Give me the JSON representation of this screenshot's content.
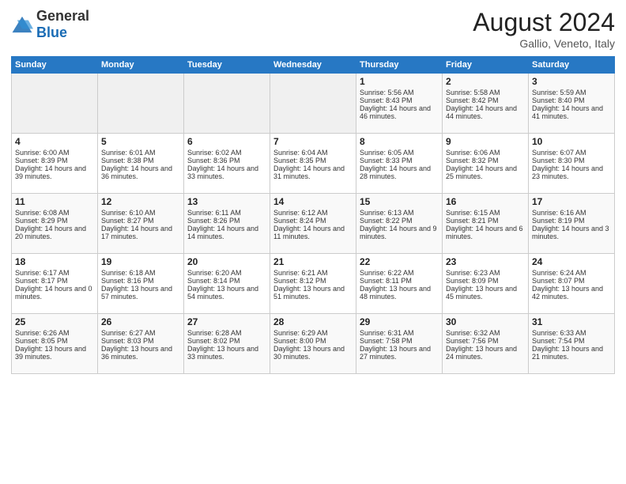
{
  "header": {
    "logo_general": "General",
    "logo_blue": "Blue",
    "title": "August 2024",
    "subtitle": "Gallio, Veneto, Italy"
  },
  "days_of_week": [
    "Sunday",
    "Monday",
    "Tuesday",
    "Wednesday",
    "Thursday",
    "Friday",
    "Saturday"
  ],
  "weeks": [
    [
      {
        "day": "",
        "info": ""
      },
      {
        "day": "",
        "info": ""
      },
      {
        "day": "",
        "info": ""
      },
      {
        "day": "",
        "info": ""
      },
      {
        "day": "1",
        "info": "Sunrise: 5:56 AM\nSunset: 8:43 PM\nDaylight: 14 hours and 46 minutes."
      },
      {
        "day": "2",
        "info": "Sunrise: 5:58 AM\nSunset: 8:42 PM\nDaylight: 14 hours and 44 minutes."
      },
      {
        "day": "3",
        "info": "Sunrise: 5:59 AM\nSunset: 8:40 PM\nDaylight: 14 hours and 41 minutes."
      }
    ],
    [
      {
        "day": "4",
        "info": "Sunrise: 6:00 AM\nSunset: 8:39 PM\nDaylight: 14 hours and 39 minutes."
      },
      {
        "day": "5",
        "info": "Sunrise: 6:01 AM\nSunset: 8:38 PM\nDaylight: 14 hours and 36 minutes."
      },
      {
        "day": "6",
        "info": "Sunrise: 6:02 AM\nSunset: 8:36 PM\nDaylight: 14 hours and 33 minutes."
      },
      {
        "day": "7",
        "info": "Sunrise: 6:04 AM\nSunset: 8:35 PM\nDaylight: 14 hours and 31 minutes."
      },
      {
        "day": "8",
        "info": "Sunrise: 6:05 AM\nSunset: 8:33 PM\nDaylight: 14 hours and 28 minutes."
      },
      {
        "day": "9",
        "info": "Sunrise: 6:06 AM\nSunset: 8:32 PM\nDaylight: 14 hours and 25 minutes."
      },
      {
        "day": "10",
        "info": "Sunrise: 6:07 AM\nSunset: 8:30 PM\nDaylight: 14 hours and 23 minutes."
      }
    ],
    [
      {
        "day": "11",
        "info": "Sunrise: 6:08 AM\nSunset: 8:29 PM\nDaylight: 14 hours and 20 minutes."
      },
      {
        "day": "12",
        "info": "Sunrise: 6:10 AM\nSunset: 8:27 PM\nDaylight: 14 hours and 17 minutes."
      },
      {
        "day": "13",
        "info": "Sunrise: 6:11 AM\nSunset: 8:26 PM\nDaylight: 14 hours and 14 minutes."
      },
      {
        "day": "14",
        "info": "Sunrise: 6:12 AM\nSunset: 8:24 PM\nDaylight: 14 hours and 11 minutes."
      },
      {
        "day": "15",
        "info": "Sunrise: 6:13 AM\nSunset: 8:22 PM\nDaylight: 14 hours and 9 minutes."
      },
      {
        "day": "16",
        "info": "Sunrise: 6:15 AM\nSunset: 8:21 PM\nDaylight: 14 hours and 6 minutes."
      },
      {
        "day": "17",
        "info": "Sunrise: 6:16 AM\nSunset: 8:19 PM\nDaylight: 14 hours and 3 minutes."
      }
    ],
    [
      {
        "day": "18",
        "info": "Sunrise: 6:17 AM\nSunset: 8:17 PM\nDaylight: 14 hours and 0 minutes."
      },
      {
        "day": "19",
        "info": "Sunrise: 6:18 AM\nSunset: 8:16 PM\nDaylight: 13 hours and 57 minutes."
      },
      {
        "day": "20",
        "info": "Sunrise: 6:20 AM\nSunset: 8:14 PM\nDaylight: 13 hours and 54 minutes."
      },
      {
        "day": "21",
        "info": "Sunrise: 6:21 AM\nSunset: 8:12 PM\nDaylight: 13 hours and 51 minutes."
      },
      {
        "day": "22",
        "info": "Sunrise: 6:22 AM\nSunset: 8:11 PM\nDaylight: 13 hours and 48 minutes."
      },
      {
        "day": "23",
        "info": "Sunrise: 6:23 AM\nSunset: 8:09 PM\nDaylight: 13 hours and 45 minutes."
      },
      {
        "day": "24",
        "info": "Sunrise: 6:24 AM\nSunset: 8:07 PM\nDaylight: 13 hours and 42 minutes."
      }
    ],
    [
      {
        "day": "25",
        "info": "Sunrise: 6:26 AM\nSunset: 8:05 PM\nDaylight: 13 hours and 39 minutes."
      },
      {
        "day": "26",
        "info": "Sunrise: 6:27 AM\nSunset: 8:03 PM\nDaylight: 13 hours and 36 minutes."
      },
      {
        "day": "27",
        "info": "Sunrise: 6:28 AM\nSunset: 8:02 PM\nDaylight: 13 hours and 33 minutes."
      },
      {
        "day": "28",
        "info": "Sunrise: 6:29 AM\nSunset: 8:00 PM\nDaylight: 13 hours and 30 minutes."
      },
      {
        "day": "29",
        "info": "Sunrise: 6:31 AM\nSunset: 7:58 PM\nDaylight: 13 hours and 27 minutes."
      },
      {
        "day": "30",
        "info": "Sunrise: 6:32 AM\nSunset: 7:56 PM\nDaylight: 13 hours and 24 minutes."
      },
      {
        "day": "31",
        "info": "Sunrise: 6:33 AM\nSunset: 7:54 PM\nDaylight: 13 hours and 21 minutes."
      }
    ]
  ]
}
